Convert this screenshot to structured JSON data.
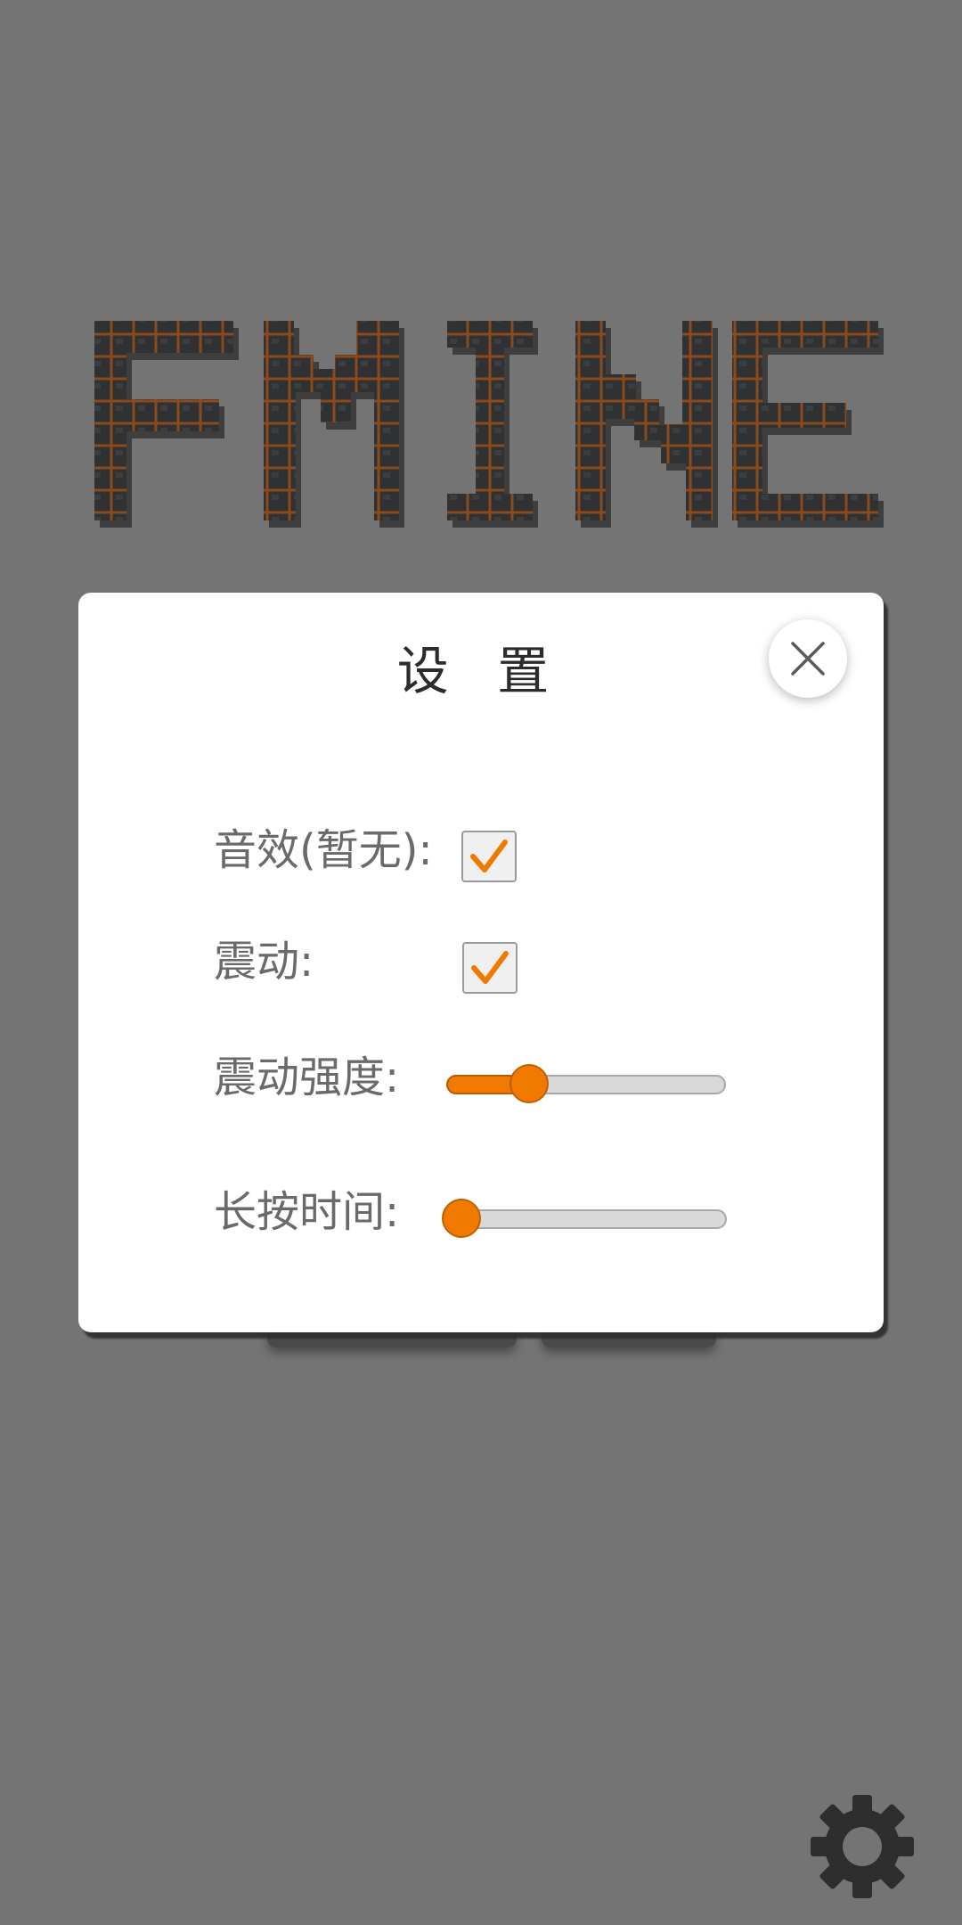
{
  "logo": {
    "text": "FMINE",
    "icon": "fmine-pixel-logo"
  },
  "dialog": {
    "title": "设 置",
    "close_icon": "close-icon",
    "rows": {
      "sound": {
        "label": "音效(暂无):",
        "checked": true
      },
      "vibration": {
        "label": "震动:",
        "checked": true
      },
      "vibration_strength": {
        "label": "震动强度:",
        "value_fraction": 0.27
      },
      "long_press_time": {
        "label": "长按时间:",
        "value_fraction": 0.0
      }
    }
  },
  "colors": {
    "background": "#747474",
    "accent": "#f07a00",
    "dialog_bg": "#ffffff",
    "logo_dark": "#2f3132",
    "logo_outline": "#8a4a1c"
  },
  "settings_button": {
    "icon": "gear-icon"
  }
}
